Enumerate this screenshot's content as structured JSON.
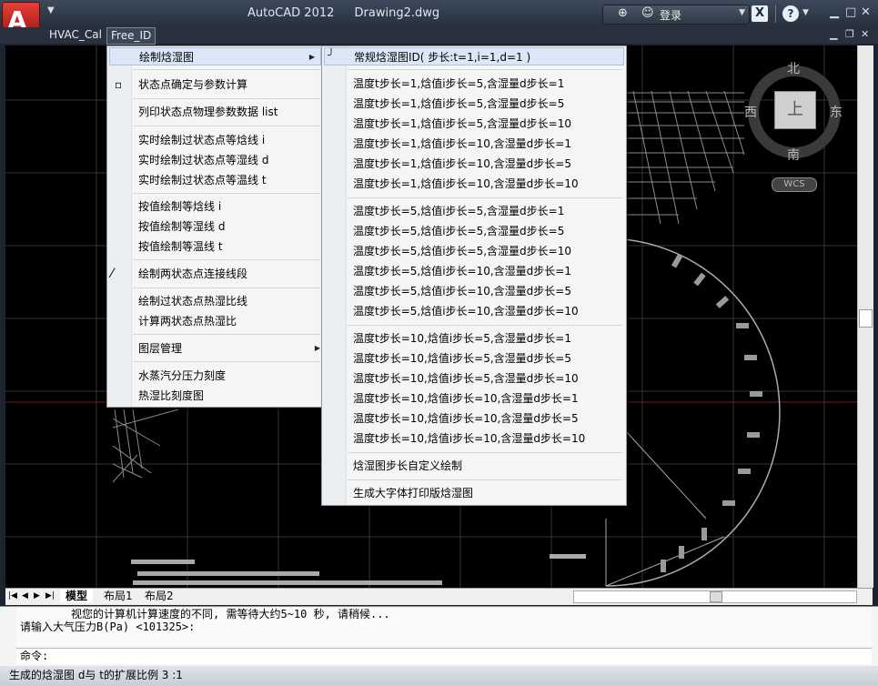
{
  "titlebar": {
    "app_name": "AutoCAD 2012",
    "document": "Drawing2.dwg",
    "login_label": "登录",
    "x_label": "X",
    "help_label": "?"
  },
  "doc_tabs": [
    "HVAC_Cal",
    "Free_ID"
  ],
  "menu1": {
    "items": [
      "绘制焓湿图",
      "状态点确定与参数计算",
      "列印状态点物理参数数据 list",
      "实时绘制过状态点等焓线 i",
      "实时绘制过状态点等湿线 d",
      "实时绘制过状态点等温线 t",
      "按值绘制等焓线 i",
      "按值绘制等湿线 d",
      "按值绘制等温线 t",
      "绘制两状态点连接线段",
      "绘制过状态点热湿比线",
      "计算两状态点热湿比",
      "图层管理",
      "水蒸汽分压力刻度",
      "热湿比刻度图"
    ]
  },
  "menu2": {
    "items": [
      "常规焓湿图ID( 步长:t=1,i=1,d=1 )",
      "温度t步长=1,焓值i步长=5,含湿量d步长=1",
      "温度t步长=1,焓值i步长=5,含湿量d步长=5",
      "温度t步长=1,焓值i步长=5,含湿量d步长=10",
      "温度t步长=1,焓值i步长=10,含湿量d步长=1",
      "温度t步长=1,焓值i步长=10,含湿量d步长=5",
      "温度t步长=1,焓值i步长=10,含湿量d步长=10",
      "温度t步长=5,焓值i步长=5,含湿量d步长=1",
      "温度t步长=5,焓值i步长=5,含湿量d步长=5",
      "温度t步长=5,焓值i步长=5,含湿量d步长=10",
      "温度t步长=5,焓值i步长=10,含湿量d步长=1",
      "温度t步长=5,焓值i步长=10,含湿量d步长=5",
      "温度t步长=5,焓值i步长=10,含湿量d步长=10",
      "温度t步长=10,焓值i步长=5,含湿量d步长=1",
      "温度t步长=10,焓值i步长=5,含湿量d步长=5",
      "温度t步长=10,焓值i步长=5,含湿量d步长=10",
      "温度t步长=10,焓值i步长=10,含湿量d步长=1",
      "温度t步长=10,焓值i步长=10,含湿量d步长=5",
      "温度t步长=10,焓值i步长=10,含湿量d步长=10",
      "焓湿图步长自定义绘制",
      "生成大字体打印版焓湿图"
    ]
  },
  "viewcube": {
    "north": "北",
    "south": "南",
    "east": "东",
    "west": "西",
    "face": "上",
    "wcs": "WCS"
  },
  "layout_tabs": [
    "模型",
    "布局1",
    "布局2"
  ],
  "command": {
    "history_line1": "视您的计算机计算速度的不同, 需等待大约5~10 秒, 请稍候...",
    "history_line2": "请输入大气压力B(Pa) <101325>:",
    "prompt": "命令:"
  },
  "status_text": "生成的焓湿图 d与 t的扩展比例 3 :1"
}
